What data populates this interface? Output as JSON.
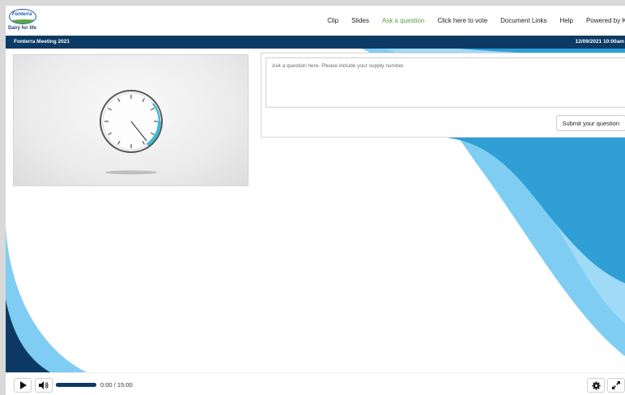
{
  "header": {
    "logo_text": "Fonterra",
    "logo_tagline": "Dairy for life",
    "nav": [
      {
        "label": "Clip",
        "active": false
      },
      {
        "label": "Slides",
        "active": false
      },
      {
        "label": "Ask a question",
        "active": true
      },
      {
        "label": "Click here to vote",
        "active": false
      },
      {
        "label": "Document Links",
        "active": false
      },
      {
        "label": "Help",
        "active": false
      },
      {
        "label": "Powered by Kid",
        "active": false
      }
    ]
  },
  "titlebar": {
    "title": "Fonterra Meeting 2021",
    "datetime": "12/09/2021 10:00am"
  },
  "video": {
    "content": "clock-icon"
  },
  "qa": {
    "placeholder": "Ask a question here. Please include your supply number.",
    "value": "",
    "submit_label": "Submit your question"
  },
  "player": {
    "current_time": "0:00",
    "separator": "/",
    "duration": "15:00",
    "progress": 0.0,
    "icons": [
      "play-icon",
      "volume-icon",
      "settings-icon",
      "fullscreen-icon"
    ]
  },
  "colors": {
    "navy": "#0c3a64",
    "accent_blue": "#2f9fd6",
    "light_blue": "#7fcdf2",
    "active_nav": "#5aa13a"
  }
}
